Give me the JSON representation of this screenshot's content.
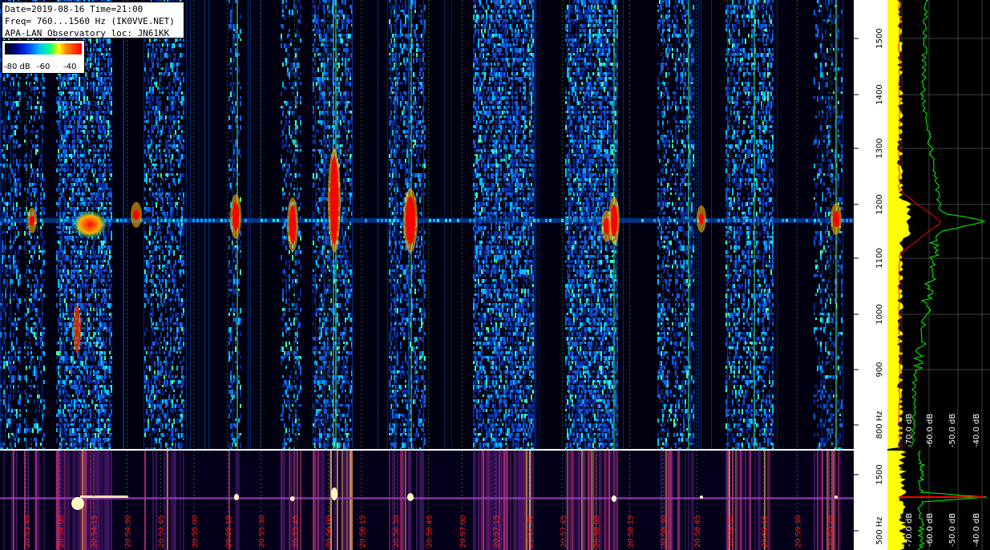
{
  "header": {
    "line1": "Date=2019-08-16 Time=21:00",
    "line2": "Freq= 760...1560 Hz (IK0VVE.NET)",
    "line3": "APA-LAN Observatory loc: JN61KK"
  },
  "legend": {
    "labels": [
      "-80 dB",
      "-60",
      "-40"
    ]
  },
  "freq_axis": {
    "ticks": [
      "1500",
      "1400",
      "1300",
      "1200",
      "1100",
      "1000",
      "900",
      "800 Hz"
    ],
    "bottom_ticks": [
      "1500",
      "500 Hz"
    ]
  },
  "spectrum_axis": {
    "labels": [
      "-70.0 dB",
      "-60.0 dB",
      "-50.0 dB",
      "-40.0 dB"
    ],
    "bottom_labels": [
      "-70.0 dB",
      "-60.0 dB",
      "-50.0 dB",
      "-40.0 dB"
    ]
  },
  "time_axis": {
    "labels": [
      "20:53:45",
      "20:54:00",
      "20:54:15",
      "20:54:30",
      "20:54:45",
      "20:55:00",
      "20:55:15",
      "20:55:30",
      "20:55:45",
      "20:56:00",
      "20:56:15",
      "20:56:30",
      "20:56:45",
      "20:57:00",
      "20:57:15",
      "20:57:30",
      "20:57:45",
      "20:58:00",
      "20:58:15",
      "20:58:30",
      "20:58:45",
      "20:59:00",
      "20:59:15",
      "20:59:30",
      "20:59:45"
    ]
  },
  "colors": {
    "background": "#000000",
    "carrier": "#ff0000",
    "grid": "#1f6a1f",
    "spectrum_avg": "#ffff00",
    "spectrum_peak": "#00ff00",
    "spectrum_ref": "#ff0000",
    "time_label": "#ff2020"
  }
}
